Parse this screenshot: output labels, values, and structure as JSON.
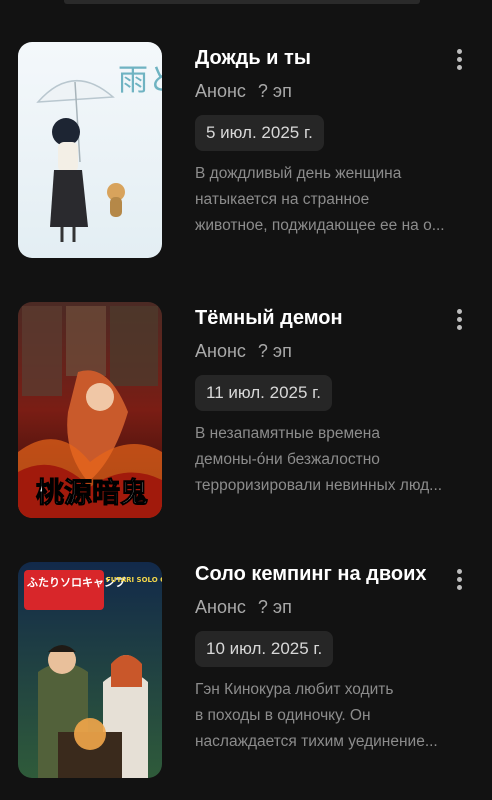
{
  "items": [
    {
      "title": "Дождь и ты",
      "status": "Анонс",
      "episodes": "? эп",
      "date": "5 июл. 2025 г.",
      "description_lines": [
        "В дождливый день женщина",
        "натыкается на странное",
        "животное, поджидающее ее на о..."
      ],
      "poster_text": "雨と君と",
      "menu_icon": "more-vert-icon"
    },
    {
      "title": "Тёмный демон",
      "status": "Анонс",
      "episodes": "? эп",
      "date": "11 июл. 2025 г.",
      "description_lines": [
        "В незапамятные времена",
        "демоны-о́ни безжалостно",
        "терроризировали невинных люд..."
      ],
      "poster_text": "桃源暗鬼",
      "menu_icon": "more-vert-icon"
    },
    {
      "title": "Соло кемпинг на двоих",
      "status": "Анонс",
      "episodes": "? эп",
      "date": "10 июл. 2025 г.",
      "description_lines": [
        "Гэн Кинокура любит ходить",
        "в походы в одиночку. Он",
        "наслаждается тихим уединение..."
      ],
      "poster_text": "ふたりソロキャンプ",
      "poster_subtext": "FUTARI SOLO CAMP",
      "menu_icon": "more-vert-icon"
    }
  ],
  "colors": {
    "background": "#121212",
    "title": "#ffffff",
    "meta": "#a9a9a9",
    "chip_bg": "#262626",
    "description": "#8c8c8c"
  }
}
